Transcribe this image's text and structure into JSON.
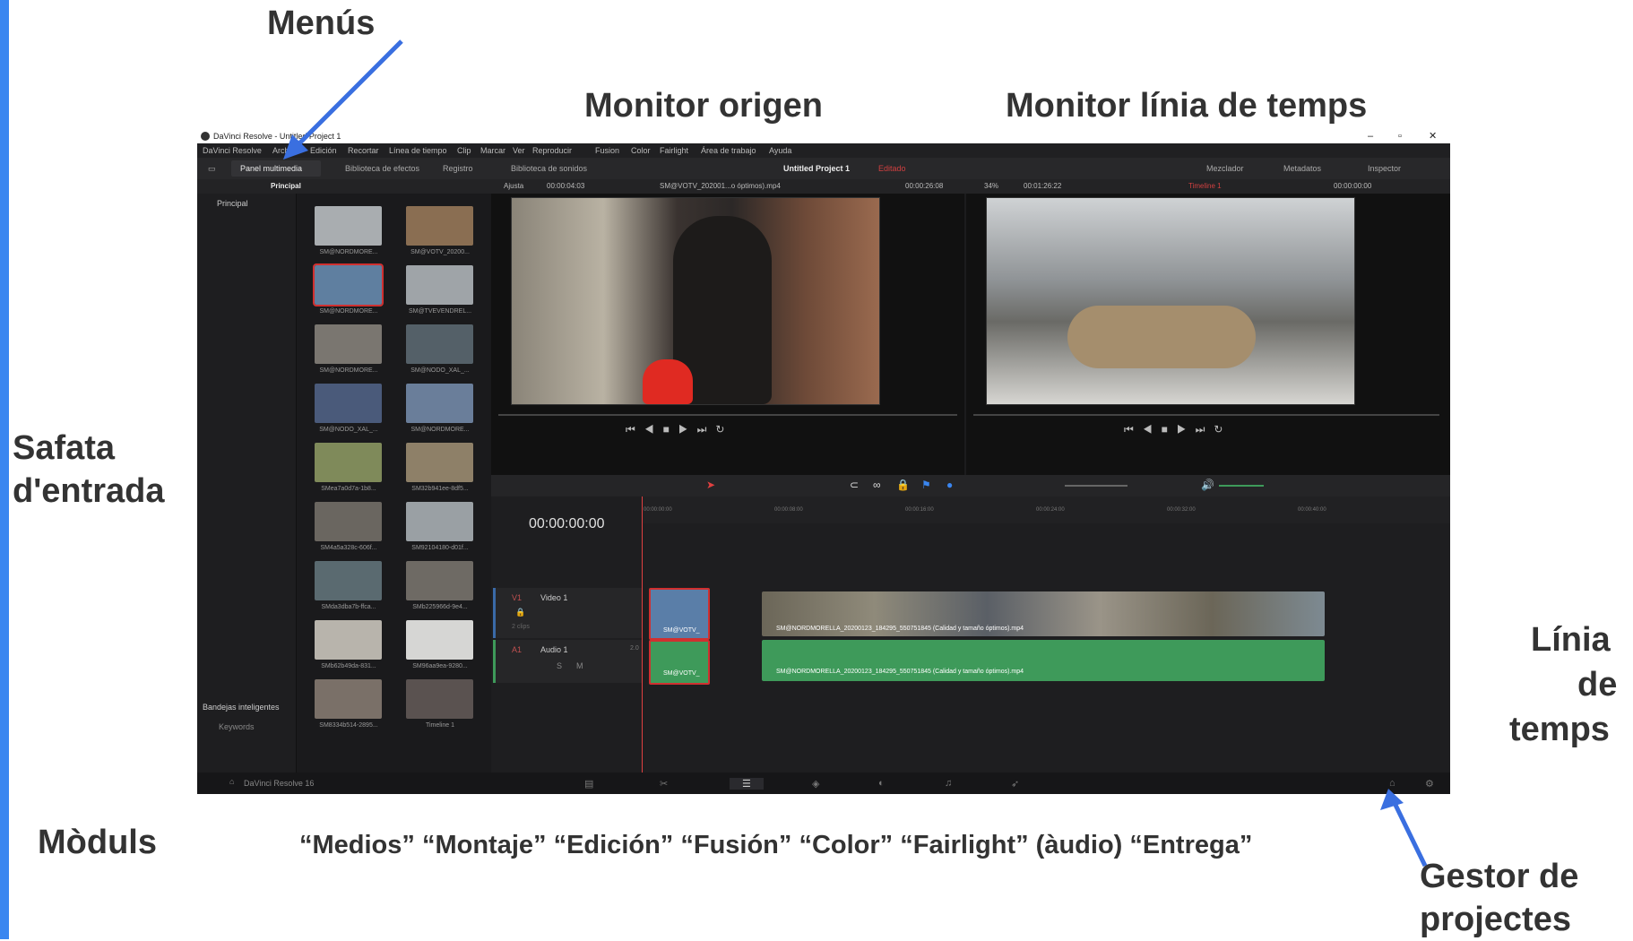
{
  "annotations": {
    "menus": "Menús",
    "source_monitor": "Monitor origen",
    "timeline_monitor": "Monitor línia de temps",
    "media_pool_line1": "Safata",
    "media_pool_line2": "d'entrada",
    "timeline_line1": "Línia",
    "timeline_line2": "de",
    "timeline_line3": "temps",
    "modules": "Mòduls",
    "modules_list": "“Medios” “Montaje” “Edición” “Fusión” “Color” “Fairlight” (àudio)  “Entrega”",
    "project_manager_line1": "Gestor de",
    "project_manager_line2": "projectes"
  },
  "app": {
    "window_title": "DaVinci Resolve - Untitled Project 1",
    "menu": [
      "DaVinci Resolve",
      "Archivo",
      "Edición",
      "Recortar",
      "Línea de tiempo",
      "Clip",
      "Marcar",
      "Ver",
      "Reproducir",
      "Fusion",
      "Color",
      "Fairlight",
      "Área de trabajo",
      "Ayuda"
    ],
    "toolbar": {
      "media_pool": "Panel multimedia",
      "effects": "Biblioteca de efectos",
      "edit_index": "Registro",
      "sound_library": "Biblioteca de sonidos",
      "project_name": "Untitled Project 1",
      "edited": "Editado",
      "mixer": "Mezclador",
      "metadata": "Metadatos",
      "inspector": "Inspector"
    },
    "subbar": {
      "bin": "Principal",
      "fit": "Ajusta",
      "src_tc": "00:00:04:03",
      "src_clip": "SM@VOTV_202001...o óptimos).mp4",
      "src_dur": "00:00:26:08",
      "zoom": "34%",
      "tl_dur": "00:01:26:22",
      "timeline_name": "Timeline 1",
      "tl_tc": "00:00:00:00"
    },
    "bins": {
      "master": "Principal",
      "smart_bins": "Bandejas inteligentes",
      "keywords": "Keywords"
    },
    "clips": [
      "SM@NORDMORE...",
      "SM@VOTV_20200...",
      "SM@NORDMORE...",
      "SM@TVEVENDREL...",
      "SM@NORDMORE...",
      "SM@NODO_XAL_...",
      "SM@NODO_XAL_...",
      "SM@NORDMORE...",
      "SMea7a0d7a-1b8...",
      "SM32b941ee-8df5...",
      "SM4a5a328c-606f...",
      "SM92104180-d01f...",
      "SMda3dba7b-ffca...",
      "SMb225966d-9e4...",
      "SMb62b49da-831...",
      "SM96aa9ea-9280...",
      "SM8334b514-2895...",
      "Timeline 1"
    ],
    "timeline": {
      "timecode": "00:00:00:00",
      "ruler": [
        "00:00:00:00",
        "00:00:08:00",
        "00:00:16:00",
        "00:00:24:00",
        "00:00:32:00",
        "00:00:40:00"
      ],
      "video_track_id": "V1",
      "video_track": "Video 1",
      "video_clips": "2 clips",
      "audio_track_id": "A1",
      "audio_track": "Audio 1",
      "audio_level": "2.0",
      "short_clip": "SM@VOTV_",
      "long_clip": "SM@NORDMORELLA_20200123_184295_550751845 (Calidad y tamaño óptimos).mp4"
    },
    "footer": {
      "app_name": "DaVinci Resolve 16"
    },
    "colors": {
      "accent": "#3a86f0",
      "audio_clip": "#3e9a5a",
      "video_clip": "#5a7ea8",
      "playhead": "#e04040",
      "edited": "#d04040"
    }
  }
}
